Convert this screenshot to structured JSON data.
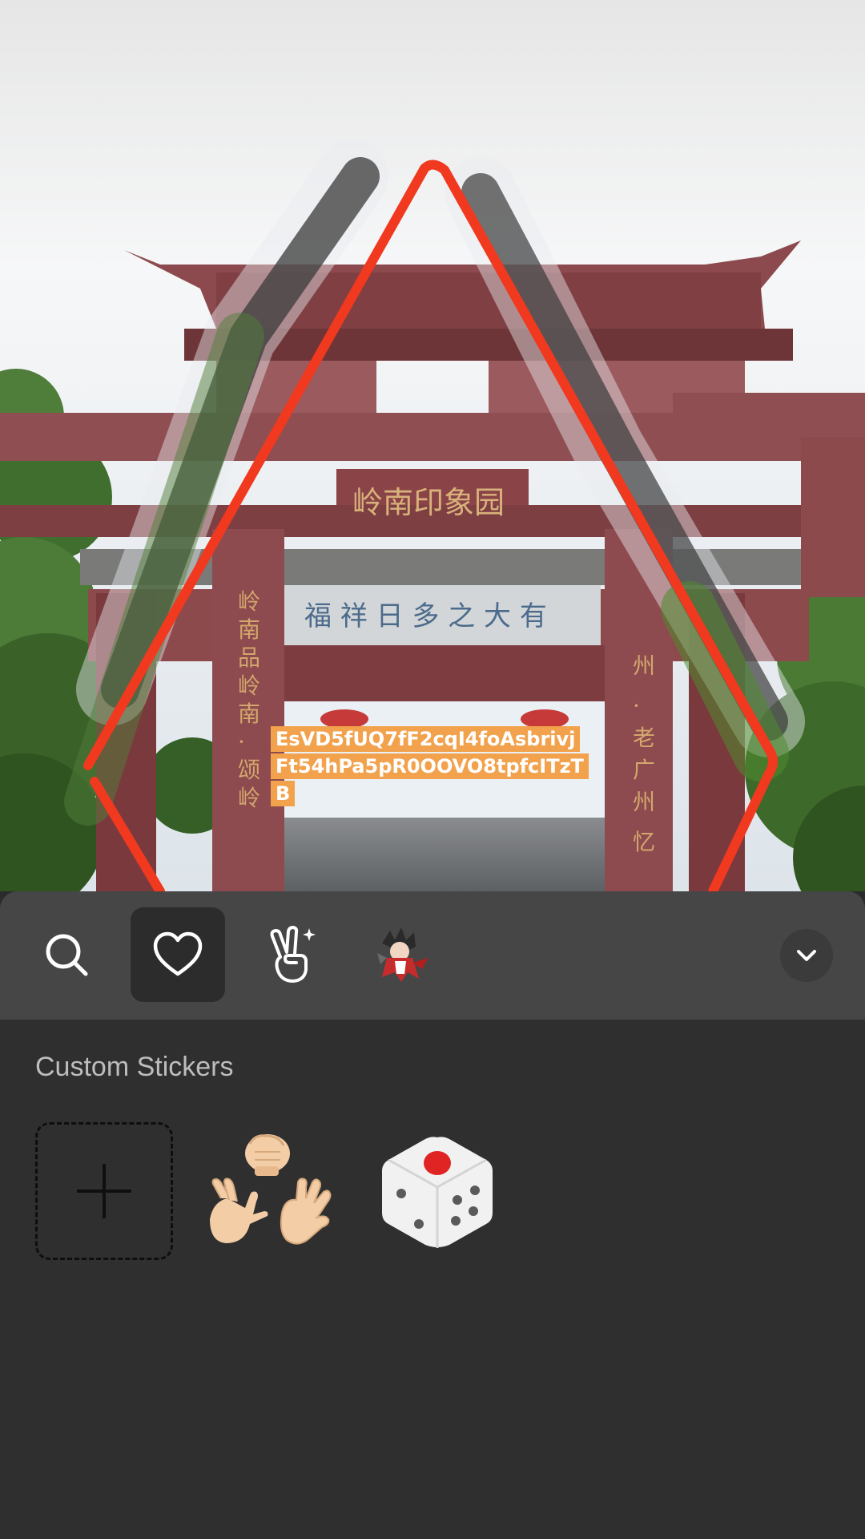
{
  "canvas": {
    "text_sticker": "EsVD5fUQ7fF2cqI4foAsbrivjFt54hPa5pR0OOVO8tpfcITzTB",
    "gate_top_inscription": "岭南印象园",
    "stroke_color_red": "#f0391f",
    "stroke_color_dark": "#3a3a3a",
    "text_sticker_bg": "#f2a24c"
  },
  "toolbar": {
    "tabs": [
      {
        "name": "search",
        "icon": "search-icon",
        "selected": false
      },
      {
        "name": "favorites",
        "icon": "heart-icon",
        "selected": true
      },
      {
        "name": "gestures",
        "icon": "peace-hand-icon",
        "selected": false
      },
      {
        "name": "anime",
        "icon": "anime-character-icon",
        "selected": false
      }
    ],
    "collapse_icon": "chevron-down-icon"
  },
  "panel": {
    "section_title": "Custom Stickers",
    "stickers": [
      {
        "name": "add",
        "icon": "plus-icon"
      },
      {
        "name": "rock-paper-scissors",
        "icon": "rock-paper-scissors-icon"
      },
      {
        "name": "dice",
        "icon": "dice-icon"
      }
    ]
  }
}
